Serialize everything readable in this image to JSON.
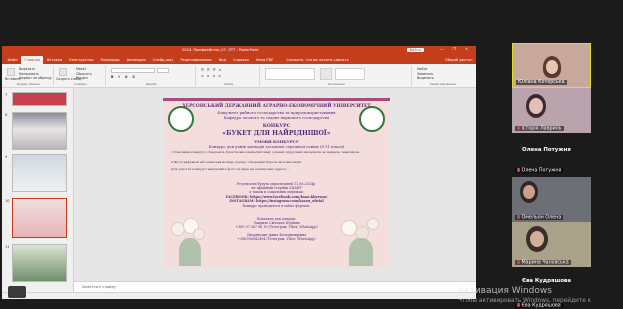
{
  "ppt": {
    "window_title": "2024. Профмайстер_07 .ЛТТ  -  PowerPoint",
    "share_label": "Войти",
    "window_controls": "— ❐ ✕",
    "tabs": [
      "Файл",
      "Главная",
      "Вставка",
      "Конструктор",
      "Переходы",
      "Анимация",
      "Слайд-шоу",
      "Рецензирование",
      "Вид",
      "Справка",
      "Hand.PDF"
    ],
    "active_tab": "Главная",
    "tell_me": "Скажите, что вы хотите сделать",
    "share_tab": "Общий доступ",
    "ribbon": {
      "groups": [
        "Буфер обмена",
        "Слайды",
        "Шрифт",
        "Абзац",
        "Рисование",
        "Редактирование"
      ],
      "paste": "Вставить",
      "cut": "Вырезать",
      "copy": "Копировать",
      "format_painter": "Формат по образцу",
      "new_slide": "Создать слайд",
      "layout": "Макет",
      "reset": "Сбросить",
      "section": "Раздел",
      "find": "Найти",
      "replace": "Заменить",
      "select": "Выделить"
    },
    "thumbnails": [
      {
        "num": "7",
        "color": "#c7404f"
      },
      {
        "num": "8",
        "color": "#c9c4c8"
      },
      {
        "num": "9",
        "color": "#cfd8e0"
      },
      {
        "num": "10",
        "color": "#e7b4b8"
      },
      {
        "num": "11",
        "color": "#d9e4d2"
      }
    ],
    "notes_placeholder": "Заметки к слайду"
  },
  "slide": {
    "university": "ХЕРСОНСЬКИЙ ДЕРЖАВНИЙ АГРАРНО-ЕКОНОМІЧНИЙ УНІВЕРСИТЕТ",
    "faculty": "Факультет рибного господарства та природокористування",
    "department": "Кафедра лісового та садово-паркового господарства",
    "contest": "КОНКУРС",
    "contest_title": "«БУКЕТ ДЛЯ НАЙРІДНІШОЇ»",
    "terms": "УМОВИ КОНКУРСУ",
    "audience": "Конкурс для учнів закладів загальної середньої освіти (8-11 класи)",
    "item1": "1.Учасники конкурсу створюють букет/композицію/світлину з різних підручних матеріалів за заданою тематикою.",
    "item2": "2.Фотографувати або записувати відео процес створення букета чи композиції.",
    "item3": "Для участі в конкурсі надсилайте фото та відео на електронну адресу ...",
    "results1": "Результати будуть оприлюднені 11.06.2024р.",
    "results2": "на офіційній сторінці ХДАЕУ",
    "results3": "а також в соціальних мережах:",
    "facebook": "FACEBOOK: https://www.facebook.com/ksau.kherson/",
    "instagram": "INSTAGRAM: https://instagram.com/ksaeu_oficial",
    "prize": "Конкурс проводиться в online форматі.",
    "contacts_title": "Контакти для довідок:",
    "contact1": "Лавриль Світлана Юріївна",
    "contact1_phone": "+380 97 567 96 10 (Телеграм, Viber, WhatsApp)",
    "contact2": "Дворянська Ірина Володимирівна",
    "contact2_phone": "+380958942494 (Телеграм, Viber, WhatsApp)"
  },
  "participants": {
    "tiles": [
      {
        "name": "Юліана Котерська",
        "type": "video",
        "speaking": true,
        "bg": "#c7a89a"
      },
      {
        "name": "Історія Лавриль",
        "type": "video",
        "speaking": false,
        "bg": "#b9a4ad",
        "muted": true
      },
      {
        "name": "Олена Потужня",
        "type": "name"
      },
      {
        "name": "Олена Потужня",
        "type": "video",
        "speaking": false,
        "bg": "#4a4a48",
        "muted": true
      },
      {
        "name": "Омельян Олена",
        "type": "video",
        "speaking": false,
        "bg": "#6c7076",
        "muted": true
      },
      {
        "name": "Марина Чаловська",
        "type": "video",
        "speaking": false,
        "bg": "#a9a189",
        "muted": true
      },
      {
        "name": "Єва Кудряшова",
        "type": "name"
      },
      {
        "name": "Єва Кудряшова",
        "type": "label-bottom"
      }
    ]
  },
  "windows": {
    "activation_title": "Активация Windows",
    "activation_hint": "Чтобы активировать Windows, перейдите к"
  }
}
